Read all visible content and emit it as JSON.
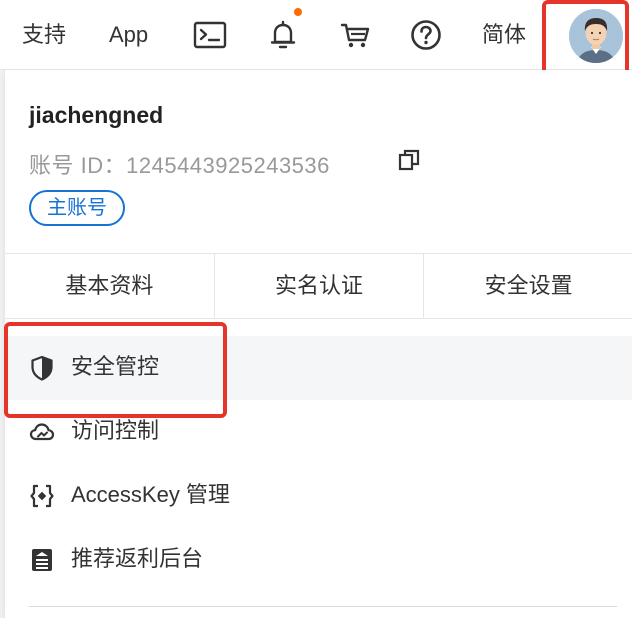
{
  "topbar": {
    "support_label": "支持",
    "app_label": "App",
    "lang_label": "简体",
    "icons": [
      "terminal-icon",
      "bell-icon",
      "cart-icon",
      "help-icon",
      "avatar"
    ],
    "accent_color": "#ff6a00"
  },
  "profile": {
    "username": "jiachengned",
    "account_id_label": "账号 ID：",
    "account_id_value": "1245443925243536",
    "badge": "主账号",
    "badge_color": "#1672d4"
  },
  "tabs": [
    "基本资料",
    "实名认证",
    "安全设置"
  ],
  "menu": [
    {
      "label": "安全管控",
      "icon": "shield-icon"
    },
    {
      "label": "访问控制",
      "icon": "cloud-icon"
    },
    {
      "label": "AccessKey 管理",
      "icon": "key-bracket-icon"
    },
    {
      "label": "推荐返利后台",
      "icon": "rebate-icon"
    }
  ],
  "highlight_color": "#e5352a"
}
